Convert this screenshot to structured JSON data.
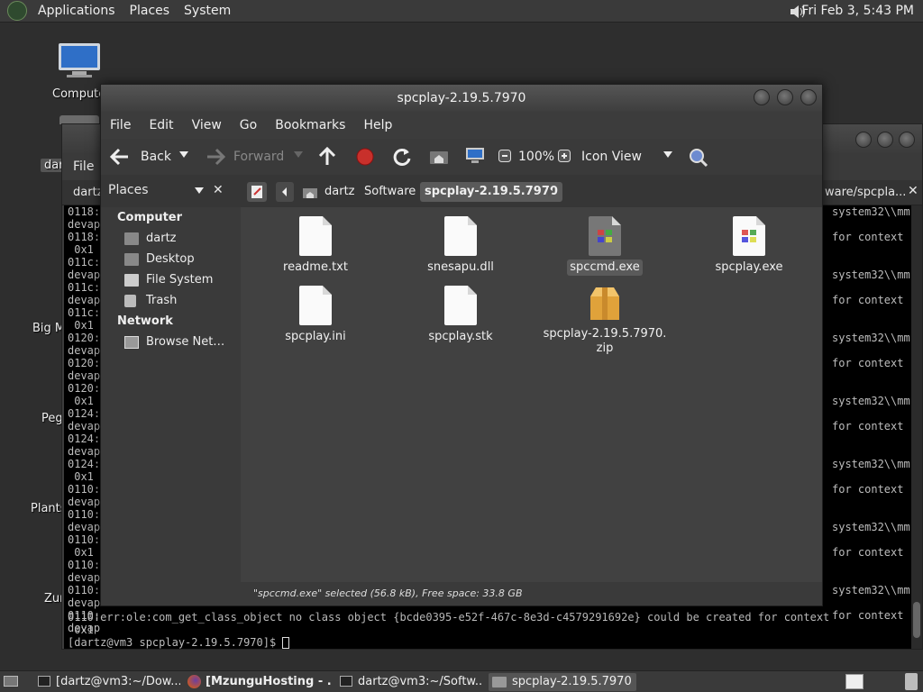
{
  "top_panel": {
    "menus": [
      "Applications",
      "Places",
      "System"
    ],
    "clock": "Fri Feb  3,  5:43 PM"
  },
  "desktop": {
    "icons": [
      "Computer",
      "dar",
      "Big M",
      "Peg",
      "Plants",
      "Zur"
    ]
  },
  "terminal": {
    "menu_label": "File",
    "tab_left": "dartz",
    "tab_right": "ware/spcpla...",
    "left_lines": [
      "0118:",
      "devap",
      "0118:",
      " 0x1",
      "011c:",
      "devap",
      "011c:",
      "devap",
      "011c:",
      " 0x1",
      "0120:",
      "devap",
      "0120:",
      "devap",
      "0120:",
      " 0x1",
      "0124:",
      "devap",
      "0124:",
      "devap",
      "0124:",
      " 0x1",
      "0110:",
      "devap",
      "0110:",
      "devap",
      "0110:",
      " 0x1",
      "0110:",
      "devap",
      "0110:",
      "devap",
      "0110:",
      "devap"
    ],
    "right_lines": [
      "system32\\\\mm",
      "",
      "for context",
      "",
      "",
      "system32\\\\mm",
      "",
      "for context",
      "",
      "",
      "system32\\\\mm",
      "",
      "for context",
      "",
      "",
      "system32\\\\mm",
      "",
      "for context",
      "",
      "",
      "system32\\\\mm",
      "",
      "for context",
      "",
      "",
      "system32\\\\mm",
      "",
      "for context",
      "",
      "",
      "system32\\\\mm",
      "",
      "for context",
      "",
      "",
      "system32\\\\mm"
    ],
    "last_error": "0110:err:ole:com_get_class_object no class object {bcde0395-e52f-467c-8e3d-c4579291692e} could be created for context",
    "last_error_2": " 0x1",
    "prompt": "[dartz@vm3 spcplay-2.19.5.7970]$ "
  },
  "file_manager": {
    "title": "spcplay-2.19.5.7970",
    "menus": [
      "File",
      "Edit",
      "View",
      "Go",
      "Bookmarks",
      "Help"
    ],
    "toolbar": {
      "back": "Back",
      "forward": "Forward",
      "zoom": "100%",
      "view_mode": "Icon View"
    },
    "sidebar_title": "Places",
    "breadcrumbs": [
      "dartz",
      "Software",
      "spcplay-2.19.5.7970"
    ],
    "sidebar": {
      "computer_header": "Computer",
      "computer_items": [
        "dartz",
        "Desktop",
        "File System",
        "Trash"
      ],
      "network_header": "Network",
      "network_items": [
        "Browse Net…"
      ]
    },
    "files": [
      {
        "name": "readme.txt",
        "icon": "text-file-icon"
      },
      {
        "name": "snesapu.dll",
        "icon": "text-file-icon"
      },
      {
        "name": "spccmd.exe",
        "icon": "exe-icon",
        "selected": true
      },
      {
        "name": "spcplay.exe",
        "icon": "exe-icon"
      },
      {
        "name": "spcplay.ini",
        "icon": "text-file-icon"
      },
      {
        "name": "spcplay.stk",
        "icon": "text-file-icon"
      },
      {
        "name": "spcplay-2.19.5.7970.",
        "name2": "zip",
        "icon": "archive-icon"
      }
    ],
    "status": "\"spccmd.exe\" selected (56.8 kB), Free space: 33.8 GB"
  },
  "taskbar": {
    "items": [
      "[dartz@vm3:~/Dow...",
      "[MzunguHosting - ...",
      "dartz@vm3:~/Softw...",
      "spcplay-2.19.5.7970"
    ]
  },
  "colors": {
    "panel": "#3a3a3a",
    "desktop": "#2e2e2e",
    "terminal_bg": "#000000",
    "record": "#d0312d"
  }
}
